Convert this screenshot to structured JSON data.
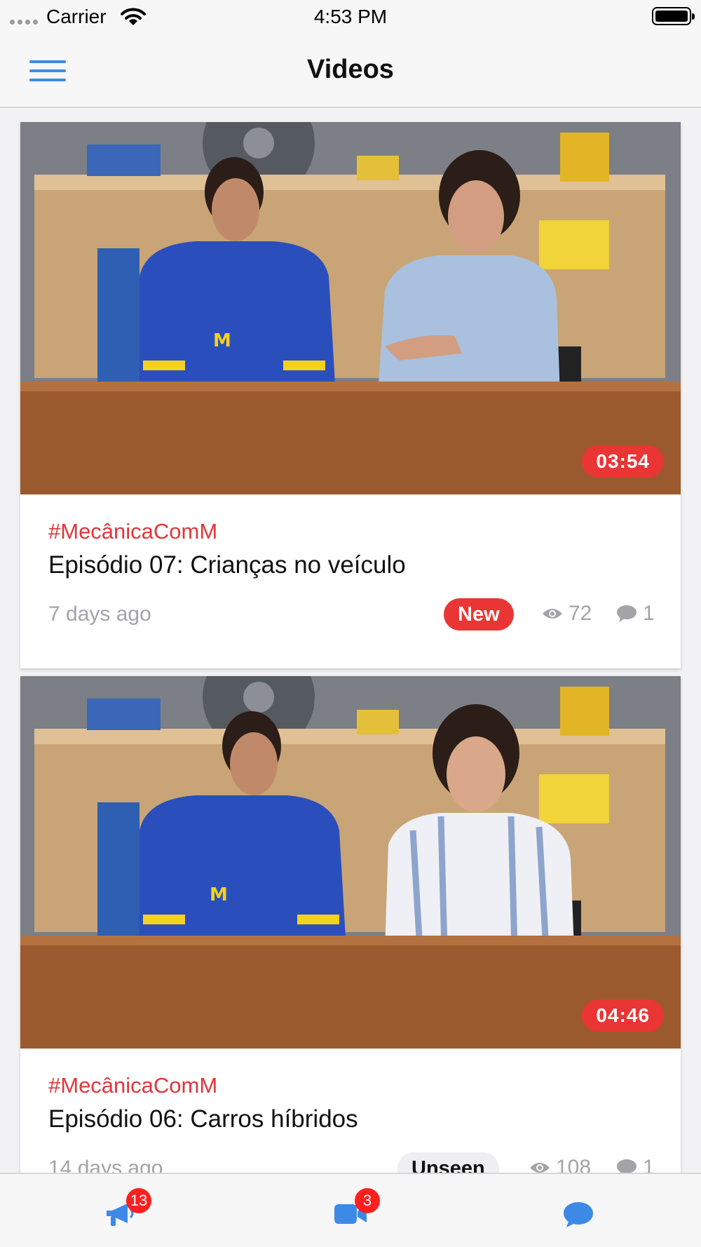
{
  "status_bar": {
    "carrier": "Carrier",
    "time": "4:53 PM"
  },
  "nav": {
    "title": "Videos"
  },
  "videos": [
    {
      "duration": "03:54",
      "tag": "#MecânicaComM",
      "title": "Episódio 07: Crianças no veículo",
      "age": "7 days ago",
      "badge": "New",
      "views": "72",
      "comments": "1"
    },
    {
      "duration": "04:46",
      "tag": "#MecânicaComM",
      "title": "Episódio 06: Carros híbridos",
      "age": "14 days ago",
      "badge": "Unseen",
      "views": "108",
      "comments": "1"
    }
  ],
  "tabs": [
    {
      "icon": "megaphone-icon",
      "badge": "13"
    },
    {
      "icon": "video-camera-icon",
      "badge": "3"
    },
    {
      "icon": "chat-bubble-icon"
    }
  ],
  "colors": {
    "accent": "#3d8ae6",
    "tag": "#e0363a",
    "badge_red": "#ea3535"
  }
}
